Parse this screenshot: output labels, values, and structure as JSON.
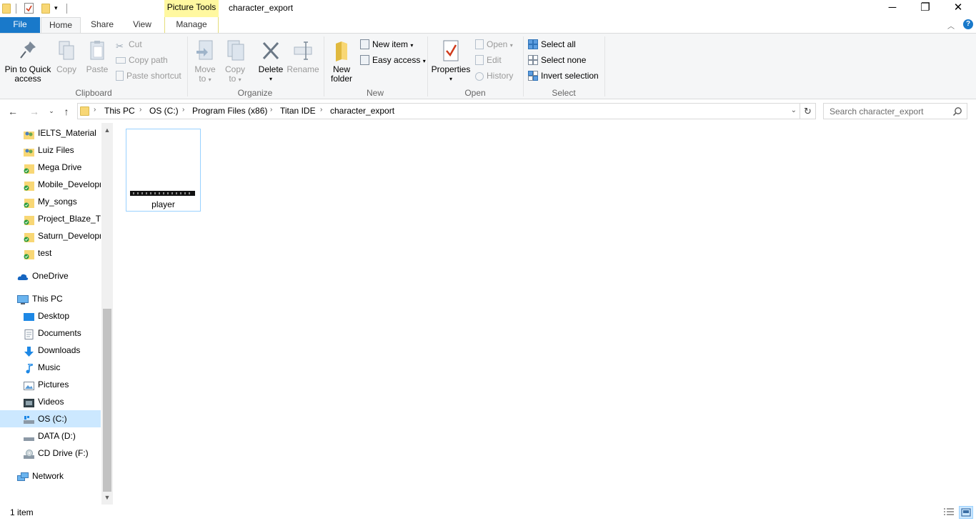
{
  "titlebar": {
    "context_tab": "Picture Tools",
    "title": "character_export",
    "minimize": "─",
    "restore": "❐",
    "close": "✕"
  },
  "tabs": {
    "file": "File",
    "home": "Home",
    "share": "Share",
    "view": "View",
    "manage": "Manage"
  },
  "ribbon": {
    "clipboard": {
      "label": "Clipboard",
      "pin_line1": "Pin to Quick",
      "pin_line2": "access",
      "copy": "Copy",
      "paste": "Paste",
      "cut": "Cut",
      "copy_path": "Copy path",
      "paste_shortcut": "Paste shortcut"
    },
    "organize": {
      "label": "Organize",
      "move_line1": "Move",
      "move_line2": "to",
      "copy_line1": "Copy",
      "copy_line2": "to",
      "delete": "Delete",
      "rename": "Rename"
    },
    "new": {
      "label": "New",
      "folder_line1": "New",
      "folder_line2": "folder",
      "new_item": "New item",
      "easy_access": "Easy access"
    },
    "open": {
      "label": "Open",
      "properties": "Properties",
      "open": "Open",
      "edit": "Edit",
      "history": "History"
    },
    "select": {
      "label": "Select",
      "select_all": "Select all",
      "select_none": "Select none",
      "invert": "Invert selection"
    }
  },
  "address": {
    "crumbs": [
      "This PC",
      "OS (C:)",
      "Program Files (x86)",
      "Titan IDE",
      "character_export"
    ],
    "search_placeholder": "Search character_export"
  },
  "navpane": {
    "items": [
      {
        "label": "IELTS_Material",
        "icon": "shared-folder-icon"
      },
      {
        "label": "Luiz Files",
        "icon": "shared-folder-icon"
      },
      {
        "label": "Mega Drive",
        "icon": "synced-folder-icon"
      },
      {
        "label": "Mobile_Development",
        "icon": "synced-folder-icon"
      },
      {
        "label": "My_songs",
        "icon": "synced-folder-icon"
      },
      {
        "label": "Project_Blaze_Tracker",
        "icon": "synced-folder-icon"
      },
      {
        "label": "Saturn_Development",
        "icon": "synced-folder-icon"
      },
      {
        "label": "test",
        "icon": "synced-folder-icon"
      },
      {
        "label": "OneDrive",
        "icon": "cloud-icon"
      },
      {
        "label": "This PC",
        "icon": "computer-icon"
      },
      {
        "label": "Desktop",
        "icon": "desktop-icon"
      },
      {
        "label": "Documents",
        "icon": "documents-icon"
      },
      {
        "label": "Downloads",
        "icon": "download-icon"
      },
      {
        "label": "Music",
        "icon": "music-icon"
      },
      {
        "label": "Pictures",
        "icon": "pictures-icon"
      },
      {
        "label": "Videos",
        "icon": "videos-icon"
      },
      {
        "label": "OS (C:)",
        "icon": "drive-icon"
      },
      {
        "label": "DATA (D:)",
        "icon": "drive-icon"
      },
      {
        "label": "CD Drive (F:)",
        "icon": "cd-drive-icon"
      },
      {
        "label": "Network",
        "icon": "network-icon"
      }
    ]
  },
  "content": {
    "file_name": "player"
  },
  "status": {
    "text": "1 item"
  },
  "colors": {
    "file_tab": "#1979ca",
    "context_tab": "#fff8a0",
    "selection": "#cce8ff",
    "folder": "#f8d775"
  }
}
